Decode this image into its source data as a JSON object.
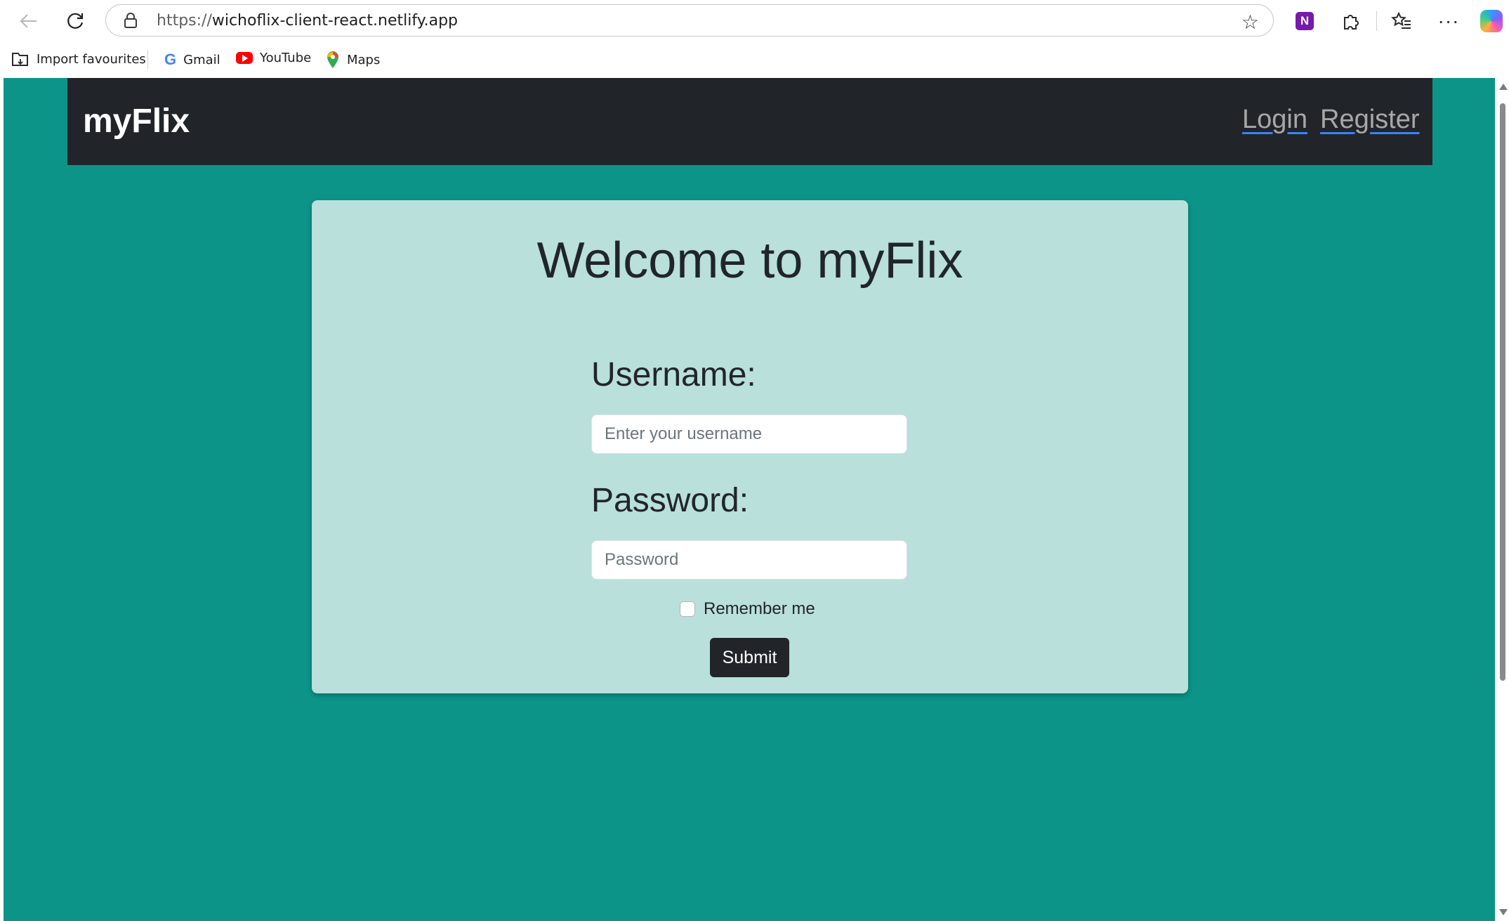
{
  "browser": {
    "url_protocol": "https://",
    "url_host": "wichoflix-client-react.netlify.app",
    "bookmarks": [
      {
        "label": "Import favourites",
        "icon": "import-folder-icon"
      },
      {
        "label": "Gmail",
        "icon": "google-icon"
      },
      {
        "label": "YouTube",
        "icon": "youtube-icon"
      },
      {
        "label": "Maps",
        "icon": "maps-pin-icon"
      }
    ],
    "onenote_letter": "N"
  },
  "navbar": {
    "brand": "myFlix",
    "links": [
      "Login",
      "Register"
    ]
  },
  "login_card": {
    "title": "Welcome to myFlix",
    "username_label": "Username:",
    "username_placeholder": "Enter your username",
    "password_label": "Password:",
    "password_placeholder": "Password",
    "remember_label": "Remember me",
    "remember_checked": false,
    "submit_label": "Submit"
  },
  "colors": {
    "page_background": "#0d9488",
    "navbar": "#212529",
    "card": "#b9e0db",
    "button": "#212529"
  }
}
